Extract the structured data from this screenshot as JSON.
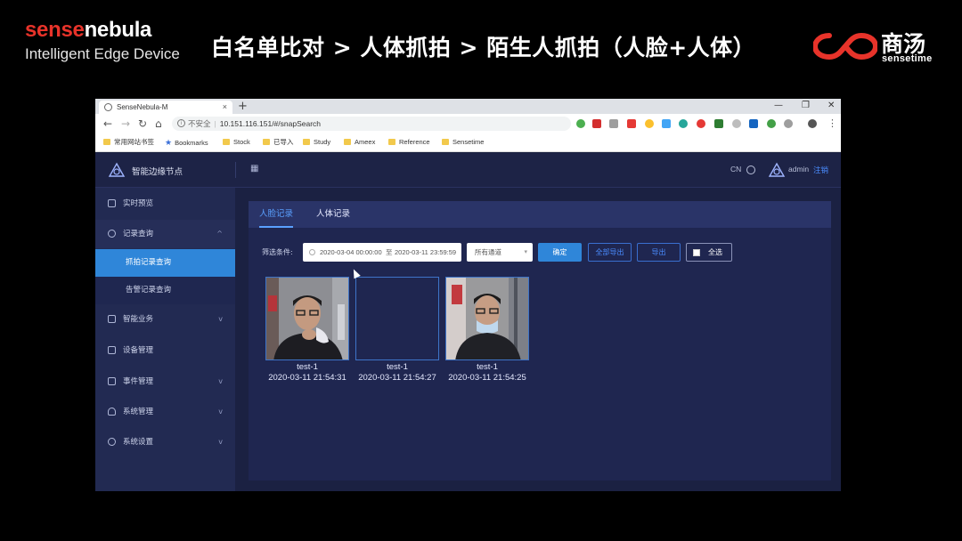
{
  "slide": {
    "brand_a": "sense",
    "brand_b": "nebula",
    "brand_sub": "Intelligent Edge Device",
    "title": "白名单比对 > 人体抓拍 > 陌生人抓拍（人脸+人体）",
    "logo_cn": "商汤",
    "logo_en": "sensetime",
    "logo_color": "#e8332a"
  },
  "browser": {
    "tab_title": "SenseNebula-M",
    "tab_close": "×",
    "new_tab": "+",
    "window_controls": [
      "—",
      "❐",
      "✕"
    ],
    "insecure_label": "不安全",
    "url": "10.151.116.151/#/snapSearch",
    "bookmarks": [
      "常用网站书签",
      "Bookmarks",
      "Stock",
      "已导入",
      "Study",
      "Ameex",
      "Reference",
      "Sensetime"
    ]
  },
  "app": {
    "name": "智能边缘节点",
    "lang": "CN",
    "user": "admin",
    "logout": "注销",
    "accent": "#2f86d9",
    "sidebar": {
      "items": [
        {
          "label": "实时预览"
        },
        {
          "label": "记录查询",
          "chevron": "^"
        },
        {
          "label": "抓拍记录查询"
        },
        {
          "label": "告警记录查询"
        },
        {
          "label": "智能业务",
          "chevron": "v"
        },
        {
          "label": "设备管理"
        },
        {
          "label": "事件管理",
          "chevron": "v"
        },
        {
          "label": "系统管理",
          "chevron": "v"
        },
        {
          "label": "系统设置",
          "chevron": "v"
        }
      ]
    },
    "tabs": [
      {
        "label": "人脸记录",
        "active": true
      },
      {
        "label": "人体记录",
        "active": false
      }
    ],
    "filter": {
      "label": "筛选条件:",
      "start": "2020-03-04 00:00:00",
      "separator": "至",
      "end": "2020-03-11 23:59:59",
      "channel": "所有通道",
      "confirm": "确定",
      "export_all": "全部导出",
      "export": "导出",
      "select_all": "全选"
    },
    "records": [
      {
        "name": "test-1",
        "time": "2020-03-11 21:54:31"
      },
      {
        "name": "test-1",
        "time": "2020-03-11 21:54:27"
      },
      {
        "name": "test-1",
        "time": "2020-03-11 21:54:25"
      }
    ]
  }
}
